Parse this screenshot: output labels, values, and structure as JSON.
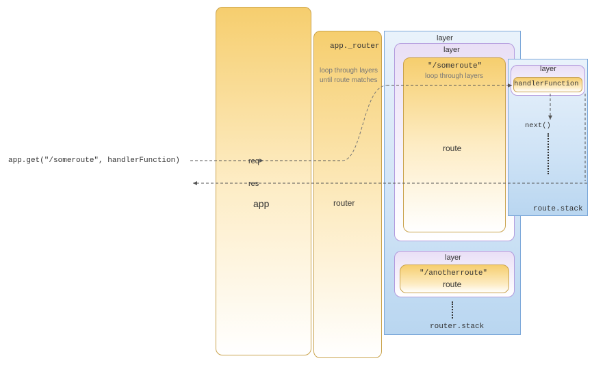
{
  "code_line": "app.get(\"/someroute\", handlerFunction)",
  "req_label": "req",
  "res_label": "res",
  "app_label": "app",
  "router_label": "router",
  "app_router_label": "app._router",
  "loop_layers_text_1": "loop through layers",
  "loop_layers_text_2": "until route matches",
  "router_stack_label": "router.stack",
  "layer_label": "layer",
  "route_label": "route",
  "someroute_path": "\"/someroute\"",
  "loop_layers_text_inner": "loop through layers",
  "route_stack_label": "route.stack",
  "layer_inner_label": "layer",
  "handler_label": "handlerFunction",
  "next_label": "next()",
  "layer2_label": "layer",
  "anotherroute_path": "\"/anotherroute\"",
  "route2_label": "route"
}
